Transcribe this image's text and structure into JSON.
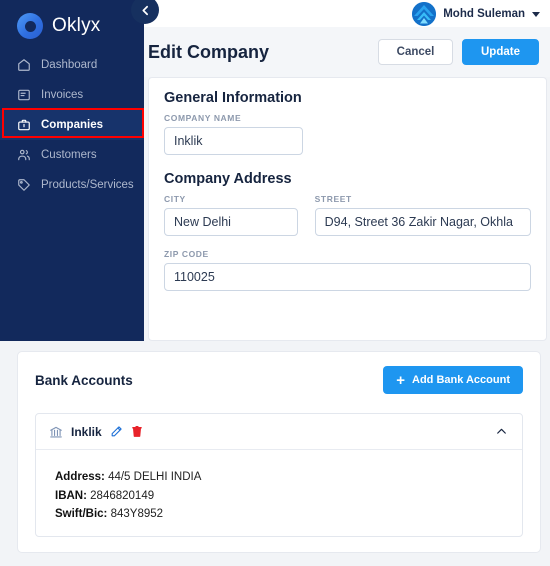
{
  "brand": {
    "name": "Oklyx",
    "logo_icon": "ring-logo-icon"
  },
  "topbar": {
    "user_name": "Mohd Suleman",
    "avatar_icon": "user-avatar-icon",
    "caret_icon": "chevron-down-icon"
  },
  "sidebar": {
    "collapse_icon": "chevron-left-icon",
    "items": [
      {
        "label": "Dashboard",
        "icon": "home-icon",
        "active": false
      },
      {
        "label": "Invoices",
        "icon": "invoice-document-icon",
        "active": false
      },
      {
        "label": "Companies",
        "icon": "briefcase-icon",
        "active": true
      },
      {
        "label": "Customers",
        "icon": "people-icon",
        "active": false
      },
      {
        "label": "Products/Services",
        "icon": "tag-icon",
        "active": false
      }
    ],
    "highlight_color": "#ff0000"
  },
  "page": {
    "title": "Edit Company",
    "cancel_label": "Cancel",
    "update_label": "Update"
  },
  "form": {
    "general_section_title": "General Information",
    "company_name_label": "COMPANY NAME",
    "company_name_value": "Inklik",
    "address_section_title": "Company Address",
    "city_label": "CITY",
    "city_value": "New Delhi",
    "street_label": "STREET",
    "street_value": "D94, Street 36 Zakir Nagar, Okhla",
    "zip_label": "ZIP CODE",
    "zip_value": "110025"
  },
  "bank": {
    "section_title": "Bank Accounts",
    "add_label": "Add Bank Account",
    "add_icon": "plus-icon",
    "account": {
      "name": "Inklik",
      "bank_icon": "bank-building-icon",
      "edit_icon": "pencil-edit-icon",
      "delete_icon": "trash-delete-icon",
      "collapse_icon": "chevron-up-icon",
      "address_label": "Address:",
      "address_value": "44/5 DELHI INDIA",
      "iban_label": "IBAN:",
      "iban_value": "2846820149",
      "swift_label": "Swift/Bic:",
      "swift_value": "843Y8952"
    }
  },
  "colors": {
    "sidebar_bg": "#12295c",
    "accent_blue": "#1e96f0",
    "delete_red": "#e8232a",
    "edit_blue": "#1b6fd6"
  }
}
